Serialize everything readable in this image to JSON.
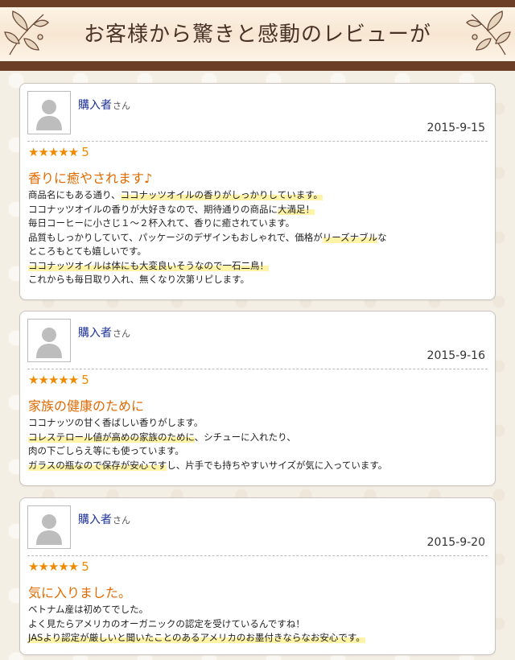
{
  "banner": {
    "title": "お客様から驚きと感動のレビューが"
  },
  "reviews": [
    {
      "reviewer": "購入者",
      "honorific": "さん",
      "date": "2015-9-15",
      "stars": "★★★★★",
      "rating": "5",
      "title": "香りに癒やされます♪",
      "lines": [
        [
          {
            "t": "商品名にもある通り、"
          },
          {
            "t": "ココナッツオイルの香りがしっかりしています。",
            "hl": true
          }
        ],
        [
          {
            "t": "ココナッツオイルの香りが大好きなので、期待通りの商品に"
          },
          {
            "t": "大満足！",
            "hl": true
          }
        ],
        [
          {
            "t": "毎日コーヒーに小さじ１～２杯入れて、香りに癒されています。"
          }
        ],
        [
          {
            "t": "品質もしっかりしていて、パッケージのデザインもおしゃれで、価格が"
          },
          {
            "t": "リーズナブル",
            "hl": true
          },
          {
            "t": "な"
          }
        ],
        [
          {
            "t": "ところもとても嬉しいです。"
          }
        ],
        [
          {
            "t": "ココナッツオイルは体にも大変良いそうなので一石二鳥！",
            "hl": true
          }
        ],
        [
          {
            "t": "これからも毎日取り入れ、無くなり次第リピします。"
          }
        ]
      ]
    },
    {
      "reviewer": "購入者",
      "honorific": "さん",
      "date": "2015-9-16",
      "stars": "★★★★★",
      "rating": "5",
      "title": "家族の健康のために",
      "lines": [
        [
          {
            "t": "ココナッツの甘く香ばしい香りがします。"
          }
        ],
        [
          {
            "t": "コレステロール値が高めの家族のために",
            "hl": true
          },
          {
            "t": "、シチューに入れたり、"
          }
        ],
        [
          {
            "t": "肉の下ごしらえ等にも使っています。"
          }
        ],
        [
          {
            "t": "ガラスの瓶なので保存が安心です",
            "hl": true
          },
          {
            "t": "し、片手でも持ちやすいサイズが気に入っています。"
          }
        ]
      ]
    },
    {
      "reviewer": "購入者",
      "honorific": "さん",
      "date": "2015-9-20",
      "stars": "★★★★★",
      "rating": "5",
      "title": "気に入りました。",
      "lines": [
        [
          {
            "t": "ベトナム産は初めてでした。"
          }
        ],
        [
          {
            "t": "よく見たらアメリカのオーガニックの認定を受けているんですね！"
          }
        ],
        [
          {
            "t": "JASより認定が厳しいと聞いたことのあるアメリカのお墨付きならなお安心です。",
            "hl": true
          }
        ]
      ]
    }
  ],
  "colors": {
    "banner_brown": "#6b3e25",
    "reviewer_blue": "#1a2f9c",
    "star_orange": "#ef8a00",
    "title_orange": "#e06a00",
    "highlight": "#fff3a8"
  },
  "icons": {
    "avatar": "user-silhouette-icon",
    "ornament": "leaf-ornament-icon"
  }
}
